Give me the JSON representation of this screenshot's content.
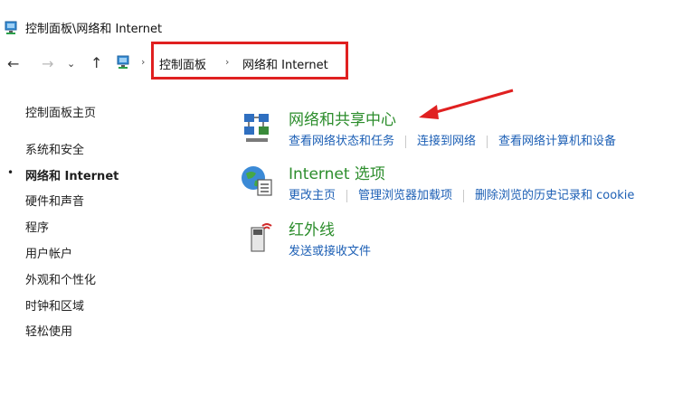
{
  "window": {
    "title": "控制面板\\网络和 Internet"
  },
  "address_bar": {
    "crumbs": [
      "控制面板",
      "网络和 Internet"
    ]
  },
  "nav": {
    "back": "←",
    "forward": "→",
    "up": "↑",
    "separator": "›"
  },
  "sidebar": {
    "home": "控制面板主页",
    "items": [
      "系统和安全",
      "网络和 Internet",
      "硬件和声音",
      "程序",
      "用户帐户",
      "外观和个性化",
      "时钟和区域",
      "轻松使用"
    ],
    "active_index": 1,
    "bullet": "•"
  },
  "categories": [
    {
      "title": "网络和共享中心",
      "icon": "network-sharing-icon",
      "links": [
        "查看网络状态和任务",
        "连接到网络",
        "查看网络计算机和设备"
      ]
    },
    {
      "title": "Internet 选项",
      "icon": "internet-options-icon",
      "links": [
        "更改主页",
        "管理浏览器加载项",
        "删除浏览的历史记录和 cookie"
      ]
    },
    {
      "title": "红外线",
      "icon": "infrared-icon",
      "links": [
        "发送或接收文件"
      ]
    }
  ],
  "colors": {
    "category_title": "#2c8d2c",
    "link": "#1c5fb5",
    "annotation": "#e02020"
  }
}
